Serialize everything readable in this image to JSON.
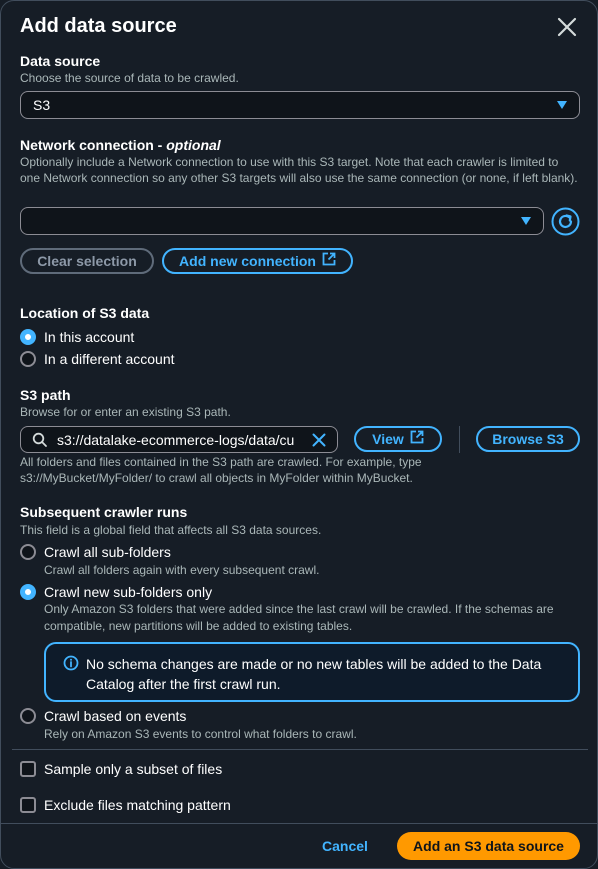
{
  "modal": {
    "title": "Add data source"
  },
  "data_source": {
    "label": "Data source",
    "description": "Choose the source of data to be crawled.",
    "selected": "S3"
  },
  "network": {
    "label": "Network connection - ",
    "label_optional": "optional",
    "description": "Optionally include a Network connection to use with this S3 target. Note that each crawler is limited to one Network connection so any other S3 targets will also use the same connection (or none, if left blank).",
    "selected": "",
    "clear_label": "Clear selection",
    "add_label": "Add new connection"
  },
  "location": {
    "label": "Location of S3 data",
    "options": [
      "In this account",
      "In a different account"
    ],
    "selected_index": 0
  },
  "s3_path": {
    "label": "S3 path",
    "description": "Browse for or enter an existing S3 path.",
    "value": "s3://datalake-ecommerce-logs/data/cu",
    "view_label": "View",
    "browse_label": "Browse S3",
    "hint": "All folders and files contained in the S3 path are crawled. For example, type s3://MyBucket/MyFolder/ to crawl all objects in MyFolder within MyBucket."
  },
  "subsequent": {
    "label": "Subsequent crawler runs",
    "description": "This field is a global field that affects all S3 data sources.",
    "options": [
      {
        "label": "Crawl all sub-folders",
        "description": "Crawl all folders again with every subsequent crawl."
      },
      {
        "label": "Crawl new sub-folders only",
        "description": "Only Amazon S3 folders that were added since the last crawl will be crawled. If the schemas are compatible, new partitions will be added to existing tables."
      },
      {
        "label": "Crawl based on events",
        "description": "Rely on Amazon S3 events to control what folders to crawl."
      }
    ],
    "selected_index": 1,
    "info_alert": "No schema changes are made or no new tables will be added to the Data Catalog after the first crawl run."
  },
  "checkboxes": [
    {
      "label": "Sample only a subset of files",
      "checked": false
    },
    {
      "label": "Exclude files matching pattern",
      "checked": false
    }
  ],
  "footer": {
    "cancel_label": "Cancel",
    "submit_label": "Add an S3 data source"
  },
  "colors": {
    "accent": "#42b4ff",
    "primary": "#ff9900",
    "background": "#161d26",
    "input_bg": "#0f141a"
  }
}
